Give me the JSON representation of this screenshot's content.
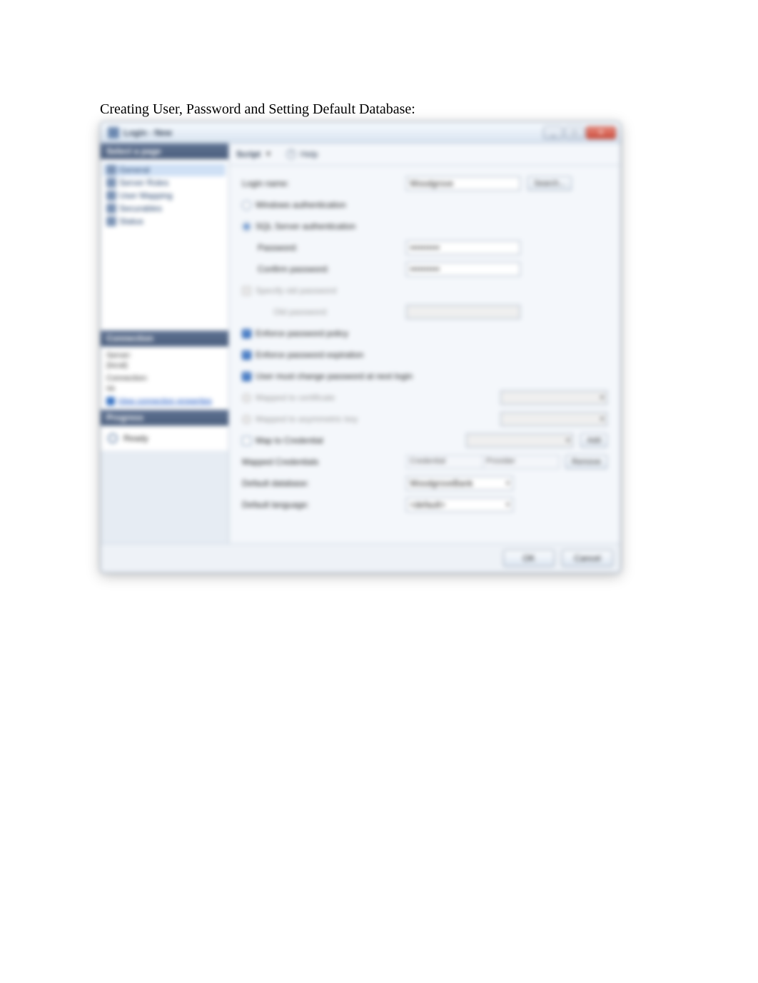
{
  "caption": "Creating User, Password and Setting Default Database:",
  "window": {
    "title": "Login - New",
    "min": "_",
    "max": "□",
    "close": "✕"
  },
  "left": {
    "select_page_hdr": "Select a page",
    "pages": [
      "General",
      "Server Roles",
      "User Mapping",
      "Securables",
      "Status"
    ],
    "connection_hdr": "Connection",
    "connection": {
      "server_lbl": "Server:",
      "server_val": "(local)",
      "conn_lbl": "Connection:",
      "conn_val": "sa",
      "view_link": "View connection properties"
    },
    "progress_hdr": "Progress",
    "progress_val": "Ready"
  },
  "script": {
    "label": "Script",
    "help": "Help"
  },
  "form": {
    "login_name_lbl": "Login name:",
    "login_name_val": "Woodgrove",
    "search_btn": "Search...",
    "windows_auth": "Windows authentication",
    "sql_auth": "SQL Server authentication",
    "password_lbl": "Password:",
    "password_val": "●●●●●●●●●●",
    "confirm_lbl": "Confirm password:",
    "confirm_val": "●●●●●●●●●●",
    "specify_old_lbl": "Specify old password",
    "old_pw_lbl": "Old password:",
    "enforce_policy": "Enforce password policy",
    "enforce_expiration": "Enforce password expiration",
    "must_change": "User must change password at next login",
    "mapped_cert_lbl": "Mapped to certificate",
    "mapped_key_lbl": "Mapped to asymmetric key",
    "map_cred_lbl": "Map to Credential",
    "add_btn": "Add",
    "mapped_creds_lbl": "Mapped Credentials",
    "cred_col": "Credential",
    "prov_col": "Provider",
    "remove_btn": "Remove",
    "default_db_lbl": "Default database:",
    "default_db_val": "WoodgroveBank",
    "default_lang_lbl": "Default language:",
    "default_lang_val": "<default>"
  },
  "footer": {
    "ok": "OK",
    "cancel": "Cancel"
  }
}
